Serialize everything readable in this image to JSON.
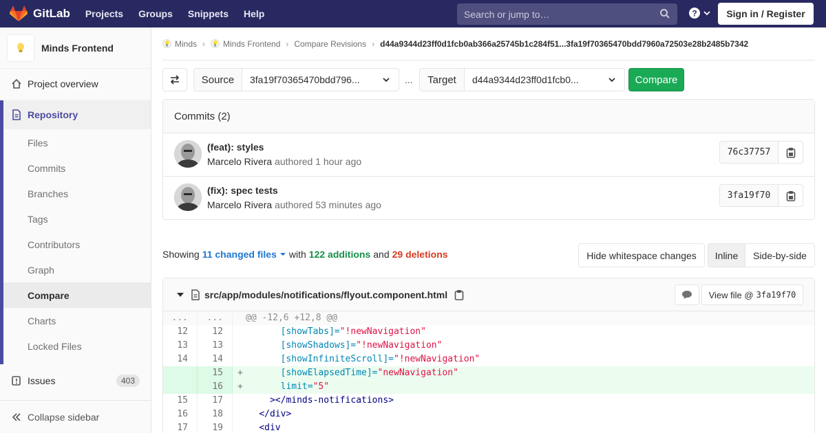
{
  "navbar": {
    "brand": "GitLab",
    "links": [
      "Projects",
      "Groups",
      "Snippets",
      "Help"
    ],
    "search_placeholder": "Search or jump to…",
    "signin_label": "Sign in / Register",
    "colors": {
      "background": "#292961",
      "accent": "#fc6d26"
    }
  },
  "sidebar": {
    "project_name": "Minds Frontend",
    "overview_label": "Project overview",
    "repository_label": "Repository",
    "repo_items": [
      "Files",
      "Commits",
      "Branches",
      "Tags",
      "Contributors",
      "Graph",
      "Compare",
      "Charts",
      "Locked Files"
    ],
    "active_item": "Compare",
    "issues_label": "Issues",
    "issues_count": "403",
    "collapse_label": "Collapse sidebar"
  },
  "breadcrumb": {
    "items": [
      "Minds",
      "Minds Frontend",
      "Compare Revisions"
    ],
    "current": "d44a9344d23ff0d1fcb0ab366a25745b1c284f51...3fa19f70365470bdd7960a72503e28b2485b7342"
  },
  "compare": {
    "source_label": "Source",
    "source_value": "3fa19f70365470bdd796...",
    "separator": "...",
    "target_label": "Target",
    "target_value": "d44a9344d23ff0d1fcb0...",
    "button_label": "Compare"
  },
  "commits": {
    "header": "Commits (2)",
    "items": [
      {
        "title": "(feat): styles",
        "author": "Marcelo Rivera",
        "verb": "authored",
        "time": "1 hour ago",
        "sha": "76c37757"
      },
      {
        "title": "(fix): spec tests",
        "author": "Marcelo Rivera",
        "verb": "authored",
        "time": "53 minutes ago",
        "sha": "3fa19f70"
      }
    ]
  },
  "stats": {
    "showing": "Showing",
    "files": "11 changed files",
    "with": "with",
    "additions": "122 additions",
    "and": "and",
    "deletions": "29 deletions"
  },
  "view_options": {
    "whitespace": "Hide whitespace changes",
    "inline": "Inline",
    "side_by_side": "Side-by-side"
  },
  "file": {
    "path": "src/app/modules/notifications/flyout.component.html",
    "view_file_label": "View file @",
    "view_file_sha": "3fa19f70",
    "lines": [
      {
        "type": "hunk",
        "old": "...",
        "new": "...",
        "sign": "",
        "code": "@@ -12,6 +12,8 @@"
      },
      {
        "type": "ctx",
        "old": "12",
        "new": "12",
        "sign": " ",
        "indent": "      ",
        "attr": "[showTabs]=",
        "str": "\"!newNavigation\""
      },
      {
        "type": "ctx",
        "old": "13",
        "new": "13",
        "sign": " ",
        "indent": "      ",
        "attr": "[showShadows]=",
        "str": "\"!newNavigation\""
      },
      {
        "type": "ctx",
        "old": "14",
        "new": "14",
        "sign": " ",
        "indent": "      ",
        "attr": "[showInfiniteScroll]=",
        "str": "\"!newNavigation\""
      },
      {
        "type": "added",
        "old": "",
        "new": "15",
        "sign": "+",
        "indent": "      ",
        "attr": "[showElapsedTime]=",
        "str": "\"newNavigation\""
      },
      {
        "type": "added",
        "old": "",
        "new": "16",
        "sign": "+",
        "indent": "      ",
        "attr": "limit=",
        "str": "\"5\""
      },
      {
        "type": "ctx",
        "old": "15",
        "new": "17",
        "sign": " ",
        "indent": "    ",
        "tag": "></minds-notifications>"
      },
      {
        "type": "ctx",
        "old": "16",
        "new": "18",
        "sign": " ",
        "indent": "  ",
        "tag": "</div>"
      },
      {
        "type": "ctx",
        "old": "17",
        "new": "19",
        "sign": " ",
        "indent": "  ",
        "tag": "<div"
      }
    ]
  }
}
